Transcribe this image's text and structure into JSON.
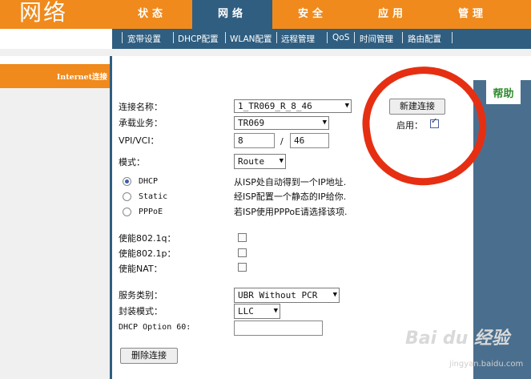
{
  "header": {
    "brand": "网络",
    "tabs": [
      {
        "label": "状态",
        "active": false
      },
      {
        "label": "网络",
        "active": true
      },
      {
        "label": "安全",
        "active": false
      },
      {
        "label": "应用",
        "active": false
      },
      {
        "label": "管理",
        "active": false
      }
    ],
    "subnav": [
      "宽带设置",
      "DHCP配置",
      "WLAN配置",
      "远程管理",
      "QoS",
      "时间管理",
      "路由配置"
    ]
  },
  "sidebar": {
    "section_label": "Internet连接"
  },
  "help": {
    "label": "帮助"
  },
  "form": {
    "connection_name": {
      "label": "连接名称：",
      "value": "1_TR069_R_8_46"
    },
    "service": {
      "label": "承载业务：",
      "value": "TR069"
    },
    "vpi_vci": {
      "label": "VPI/VCI：",
      "vpi": "8",
      "separator": "/",
      "vci": "46"
    },
    "mode": {
      "label": "模式：",
      "value": "Route"
    },
    "radios": [
      {
        "label": "DHCP",
        "desc": "从ISP处自动得到一个IP地址.",
        "checked": true
      },
      {
        "label": "Static",
        "desc": "经ISP配置一个静态的IP给你.",
        "checked": false
      },
      {
        "label": "PPPoE",
        "desc": "若ISP使用PPPoE请选择该项.",
        "checked": false
      }
    ],
    "enable_8021q": {
      "label": "使能802.1q："
    },
    "enable_8021p": {
      "label": "使能802.1p："
    },
    "enable_nat": {
      "label": "使能NAT："
    },
    "service_category": {
      "label": "服务类别：",
      "value": "UBR Without PCR"
    },
    "encapsulation": {
      "label": "封装模式：",
      "value": "LLC"
    },
    "dhcp_option60": {
      "label": "DHCP Option 60:",
      "value": ""
    },
    "delete_button": "删除连接",
    "new_button": "新建连接",
    "enable": {
      "label": "启用："
    }
  },
  "watermark": {
    "text": "Bai du 经验",
    "sub": "jingyan.baidu.com"
  },
  "colors": {
    "orange": "#f08a1c",
    "navy": "#2f5e80",
    "annotation_red": "#e62f12"
  }
}
